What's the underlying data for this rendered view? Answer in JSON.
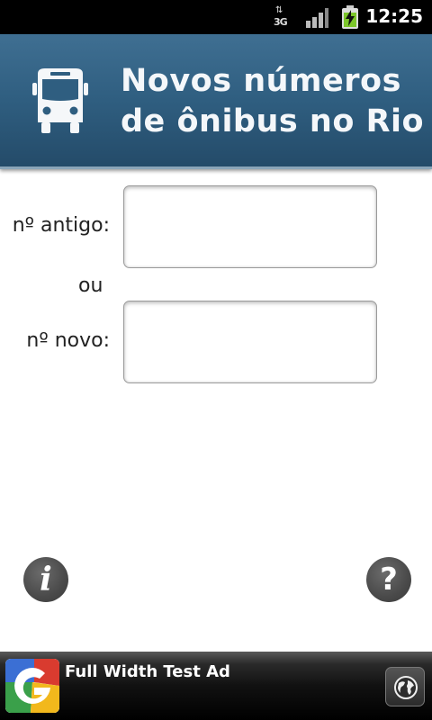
{
  "status_bar": {
    "network": "3G",
    "time": "12:25",
    "icons": [
      "data-transfer-icon",
      "signal-icon",
      "battery-charging-icon"
    ]
  },
  "header": {
    "icon": "bus-icon",
    "title_line1": "Novos números",
    "title_line2": "de ônibus no Rio"
  },
  "form": {
    "old_label": "nº antigo:",
    "or_label": "ou",
    "new_label": "nº novo:",
    "old_value": "",
    "new_value": ""
  },
  "buttons": {
    "info_symbol": "i",
    "help_symbol": "?"
  },
  "ad": {
    "text": "Full Width Test Ad",
    "logo": "google-logo-icon",
    "action_icon": "globe-icon"
  },
  "colors": {
    "header_top": "#3f6f92",
    "header_bottom": "#244b69",
    "button_gray": "#4a4a4a"
  }
}
